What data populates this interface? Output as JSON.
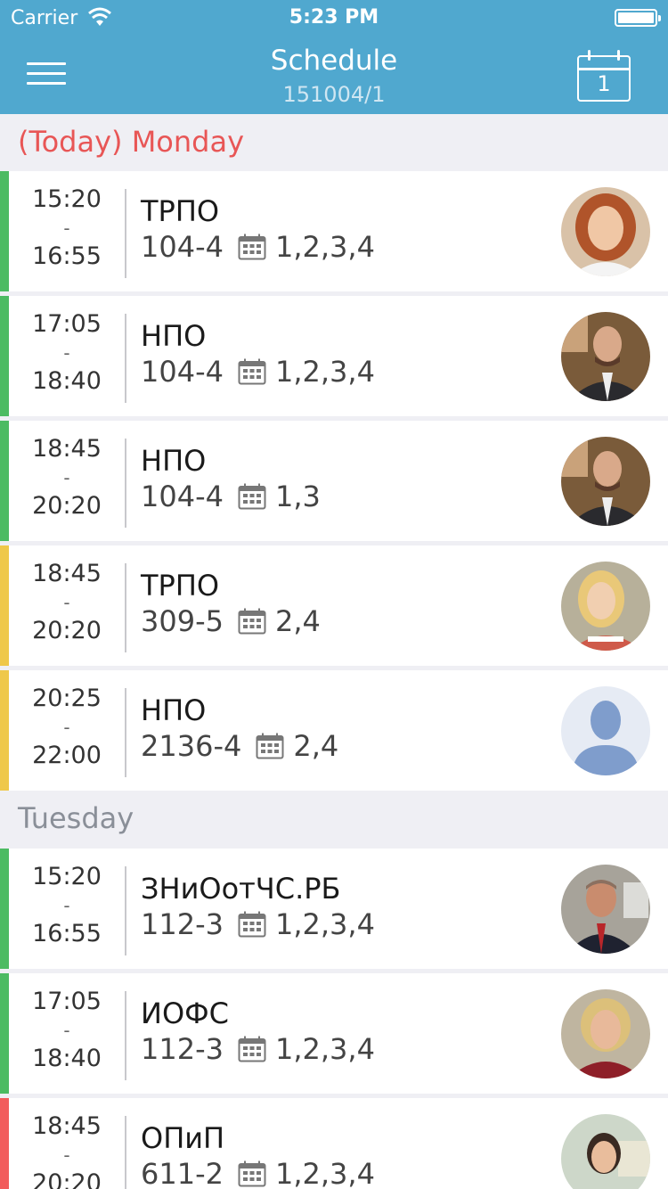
{
  "status_bar": {
    "carrier": "Carrier",
    "time": "5:23 PM"
  },
  "nav": {
    "title": "Schedule",
    "subtitle": "151004/1",
    "calendar_day": "1"
  },
  "sections": [
    {
      "header": "(Today)  Monday",
      "style": "today"
    },
    {
      "header": "Tuesday",
      "style": "normal"
    }
  ],
  "lessons": [
    {
      "start": "15:20",
      "end": "16:55",
      "subject": "ТРПО",
      "room": "104-4",
      "weeks": "1,2,3,4",
      "color": "#4cbb62",
      "avatar": "woman-redhair"
    },
    {
      "start": "17:05",
      "end": "18:40",
      "subject": "НПО",
      "room": "104-4",
      "weeks": "1,2,3,4",
      "color": "#4cbb62",
      "avatar": "man-suit"
    },
    {
      "start": "18:45",
      "end": "20:20",
      "subject": "НПО",
      "room": "104-4",
      "weeks": "1,3",
      "color": "#4cbb62",
      "avatar": "man-suit"
    },
    {
      "start": "18:45",
      "end": "20:20",
      "subject": "ТРПО",
      "room": "309-5",
      "weeks": "2,4",
      "color": "#efc84a",
      "avatar": "woman-blonde"
    },
    {
      "start": "20:25",
      "end": "22:00",
      "subject": "НПО",
      "room": "2136-4",
      "weeks": "2,4",
      "color": "#efc84a",
      "avatar": "placeholder"
    },
    {
      "start": "15:20",
      "end": "16:55",
      "subject": "ЗНиОотЧС.РБ",
      "room": "112-3",
      "weeks": "1,2,3,4",
      "color": "#4cbb62",
      "avatar": "man-elder"
    },
    {
      "start": "17:05",
      "end": "18:40",
      "subject": "ИОФС",
      "room": "112-3",
      "weeks": "1,2,3,4",
      "color": "#4cbb62",
      "avatar": "woman-blonde2"
    },
    {
      "start": "18:45",
      "end": "20:20",
      "subject": "ОПиП",
      "room": "611-2",
      "weeks": "1,2,3,4",
      "color": "#f25c5c",
      "avatar": "woman-dark"
    }
  ]
}
